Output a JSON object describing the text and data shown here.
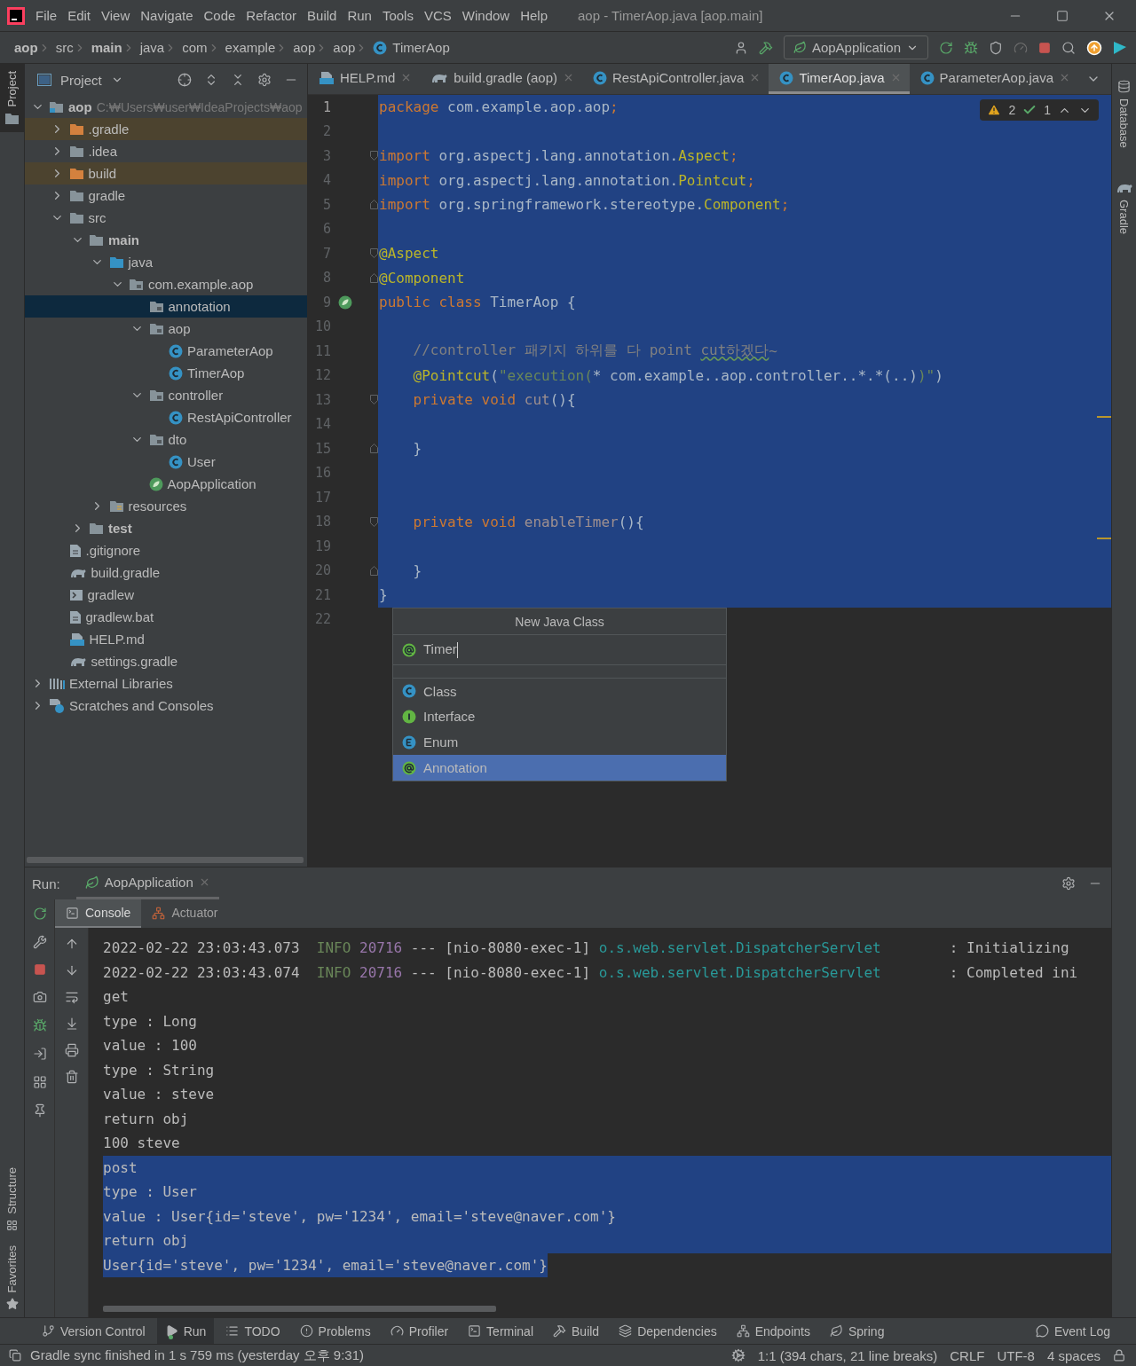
{
  "title_bar": {
    "menu": [
      "File",
      "Edit",
      "View",
      "Navigate",
      "Code",
      "Refactor",
      "Build",
      "Run",
      "Tools",
      "VCS",
      "Window",
      "Help"
    ],
    "title": "aop - TimerAop.java [aop.main]"
  },
  "breadcrumbs": [
    {
      "label": "aop",
      "kind": "dir",
      "bold": true
    },
    {
      "label": "src",
      "kind": "dir",
      "bold": false
    },
    {
      "label": "main",
      "kind": "dir",
      "bold": true
    },
    {
      "label": "java",
      "kind": "dir",
      "bold": false
    },
    {
      "label": "com",
      "kind": "dir",
      "bold": false
    },
    {
      "label": "example",
      "kind": "dir",
      "bold": false
    },
    {
      "label": "aop",
      "kind": "dir",
      "bold": false
    },
    {
      "label": "aop",
      "kind": "dir",
      "bold": false
    },
    {
      "label": "TimerAop",
      "kind": "class",
      "bold": false
    }
  ],
  "run_config": "AopApplication",
  "left_stripe": {
    "top": [
      {
        "label": "Project",
        "selected": true
      }
    ],
    "bottom": [
      {
        "label": "Structure",
        "selected": false
      },
      {
        "label": "Favorites",
        "selected": false
      }
    ]
  },
  "right_stripe": [
    {
      "label": "Database",
      "kind": "database"
    },
    {
      "label": "Gradle",
      "kind": "gradle"
    }
  ],
  "project_panel": {
    "title": "Project",
    "tree": [
      {
        "label": "aop",
        "kind": "module",
        "bold": true,
        "path": "C:₩Users₩user₩IdeaProjects₩aop",
        "expanded": true,
        "selected": false,
        "children": [
          {
            "label": ".gradle",
            "kind": "folder-excluded",
            "expanded": false,
            "selected": false
          },
          {
            "label": ".idea",
            "kind": "folder",
            "expanded": false,
            "selected": false
          },
          {
            "label": "build",
            "kind": "folder-excluded",
            "expanded": false,
            "selected": false
          },
          {
            "label": "gradle",
            "kind": "folder",
            "expanded": false,
            "selected": false
          },
          {
            "label": "src",
            "kind": "folder",
            "expanded": true,
            "selected": false,
            "children": [
              {
                "label": "main",
                "kind": "folder",
                "bold": true,
                "expanded": true,
                "selected": false,
                "children": [
                  {
                    "label": "java",
                    "kind": "source-folder",
                    "expanded": true,
                    "selected": false,
                    "children": [
                      {
                        "label": "com.example.aop",
                        "kind": "package",
                        "expanded": true,
                        "selected": false,
                        "children": [
                          {
                            "label": "annotation",
                            "kind": "package",
                            "selected": true
                          },
                          {
                            "label": "aop",
                            "kind": "package",
                            "expanded": true,
                            "selected": false,
                            "children": [
                              {
                                "label": "ParameterAop",
                                "kind": "class",
                                "selected": false
                              },
                              {
                                "label": "TimerAop",
                                "kind": "class",
                                "selected": false
                              }
                            ]
                          },
                          {
                            "label": "controller",
                            "kind": "package",
                            "expanded": true,
                            "selected": false,
                            "children": [
                              {
                                "label": "RestApiController",
                                "kind": "class",
                                "selected": false
                              }
                            ]
                          },
                          {
                            "label": "dto",
                            "kind": "package",
                            "expanded": true,
                            "selected": false,
                            "children": [
                              {
                                "label": "User",
                                "kind": "class",
                                "selected": false
                              }
                            ]
                          },
                          {
                            "label": "AopApplication",
                            "kind": "spring",
                            "selected": false
                          }
                        ]
                      }
                    ]
                  },
                  {
                    "label": "resources",
                    "kind": "resources",
                    "expanded": false,
                    "selected": false
                  }
                ]
              },
              {
                "label": "test",
                "kind": "folder",
                "bold": true,
                "expanded": false,
                "selected": false
              }
            ]
          },
          {
            "label": ".gitignore",
            "kind": "file",
            "selected": false
          },
          {
            "label": "build.gradle",
            "kind": "gradle",
            "selected": false
          },
          {
            "label": "gradlew",
            "kind": "script",
            "selected": false
          },
          {
            "label": "gradlew.bat",
            "kind": "file",
            "selected": false
          },
          {
            "label": "HELP.md",
            "kind": "md",
            "selected": false
          },
          {
            "label": "settings.gradle",
            "kind": "gradle",
            "selected": false
          }
        ]
      },
      {
        "label": "External Libraries",
        "kind": "libraries",
        "expanded": false,
        "selected": false
      },
      {
        "label": "Scratches and Consoles",
        "kind": "scratches",
        "expanded": false,
        "selected": false
      }
    ]
  },
  "editor": {
    "tabs": [
      {
        "label": "HELP.md",
        "kind": "md",
        "selected": false
      },
      {
        "label": "build.gradle (aop)",
        "kind": "gradle",
        "selected": false
      },
      {
        "label": "RestApiController.java",
        "kind": "class",
        "selected": false
      },
      {
        "label": "TimerAop.java",
        "kind": "class",
        "selected": true
      },
      {
        "label": "ParameterAop.java",
        "kind": "class",
        "selected": false
      }
    ],
    "inspections": {
      "warnings": "2",
      "weak_warnings": "1"
    },
    "lines": [
      {
        "number": "1",
        "current": true,
        "selected": true,
        "tokens": [
          {
            "text": "package",
            "kind": "kw"
          },
          {
            "text": " com.example.aop.aop",
            "kind": "id"
          },
          {
            "text": ";",
            "kind": "kw"
          }
        ]
      },
      {
        "number": "2",
        "selected": true
      },
      {
        "number": "3",
        "selected": true,
        "fold_start": true,
        "tokens": [
          {
            "text": "import",
            "kind": "kw"
          },
          {
            "text": " org.aspectj.lang.annotation.",
            "kind": "id"
          },
          {
            "text": "Aspect",
            "kind": "ann"
          },
          {
            "text": ";",
            "kind": "kw"
          }
        ]
      },
      {
        "number": "4",
        "selected": true,
        "tokens": [
          {
            "text": "import",
            "kind": "kw"
          },
          {
            "text": " org.aspectj.lang.annotation.",
            "kind": "id"
          },
          {
            "text": "Pointcut",
            "kind": "ann"
          },
          {
            "text": ";",
            "kind": "kw"
          }
        ]
      },
      {
        "number": "5",
        "selected": true,
        "fold_end": true,
        "tokens": [
          {
            "text": "import",
            "kind": "kw"
          },
          {
            "text": " org.springframework.stereotype.",
            "kind": "id"
          },
          {
            "text": "Component",
            "kind": "ann"
          },
          {
            "text": ";",
            "kind": "kw"
          }
        ]
      },
      {
        "number": "6",
        "selected": true
      },
      {
        "number": "7",
        "selected": true,
        "fold_start": true,
        "tokens": [
          {
            "text": "@Aspect",
            "kind": "ann"
          }
        ]
      },
      {
        "number": "8",
        "selected": true,
        "fold_end": true,
        "tokens": [
          {
            "text": "@Component",
            "kind": "ann"
          }
        ]
      },
      {
        "number": "9",
        "selected": true,
        "bean": true,
        "tokens": [
          {
            "text": "public class",
            "kind": "kw"
          },
          {
            "text": " TimerAop {",
            "kind": "id"
          }
        ]
      },
      {
        "number": "10",
        "selected": true
      },
      {
        "number": "11",
        "selected": true,
        "tokens": [
          {
            "text": "    //controller 패키지 하위를 다 point ",
            "kind": "cmt"
          },
          {
            "text": "cut하겠다",
            "kind": "typo"
          },
          {
            "text": "~",
            "kind": "cmt"
          }
        ]
      },
      {
        "number": "12",
        "selected": true,
        "tokens": [
          {
            "text": "    @Pointcut",
            "kind": "ann"
          },
          {
            "text": "(",
            "kind": "id"
          },
          {
            "text": "\"execution(",
            "kind": "str"
          },
          {
            "text": "* com.example..aop.controller..*.*(..)",
            "kind": "id"
          },
          {
            "text": ")\"",
            "kind": "str"
          },
          {
            "text": ")",
            "kind": "id"
          }
        ]
      },
      {
        "number": "13",
        "selected": true,
        "fold_start": true,
        "tokens": [
          {
            "text": "    private void ",
            "kind": "kw"
          },
          {
            "text": "cut",
            "kind": "unused"
          },
          {
            "text": "(){",
            "kind": "id"
          }
        ]
      },
      {
        "number": "14",
        "selected": true
      },
      {
        "number": "15",
        "selected": true,
        "fold_end": true,
        "tokens": [
          {
            "text": "    }",
            "kind": "id"
          }
        ]
      },
      {
        "number": "16",
        "selected": true
      },
      {
        "number": "17",
        "selected": true
      },
      {
        "number": "18",
        "selected": true,
        "fold_start": true,
        "tokens": [
          {
            "text": "    private void ",
            "kind": "kw"
          },
          {
            "text": "enableTimer",
            "kind": "unused"
          },
          {
            "text": "(){",
            "kind": "id"
          }
        ]
      },
      {
        "number": "19",
        "selected": true
      },
      {
        "number": "20",
        "selected": true,
        "fold_end": true,
        "tokens": [
          {
            "text": "    }",
            "kind": "id"
          }
        ]
      },
      {
        "number": "21",
        "selected": true,
        "tokens": [
          {
            "text": "}",
            "kind": "id"
          }
        ]
      },
      {
        "number": "22",
        "selected": false
      }
    ]
  },
  "popup": {
    "title": "New Java Class",
    "value": "Timer",
    "options": [
      {
        "label": "Class",
        "kind": "class",
        "selected": false
      },
      {
        "label": "Interface",
        "kind": "interface",
        "selected": false
      },
      {
        "label": "Enum",
        "kind": "enum",
        "selected": false
      },
      {
        "label": "Annotation",
        "kind": "annotation",
        "selected": true
      }
    ]
  },
  "run_panel": {
    "label": "Run:",
    "tab": "AopApplication",
    "subtabs": [
      {
        "label": "Console",
        "kind": "console",
        "selected": true
      },
      {
        "label": "Actuator",
        "kind": "actuator",
        "selected": false
      }
    ],
    "lines": [
      {
        "kind": "log",
        "date": "2022-02-22 23:03:43.073",
        "level": "INFO",
        "pid": "20716",
        "sep": "---",
        "thread": "[nio-8080-exec-1]",
        "logger": "o.s.web.servlet.DispatcherServlet",
        "colon": ":",
        "message": "Initializing"
      },
      {
        "kind": "log",
        "date": "2022-02-22 23:03:43.074",
        "level": "INFO",
        "pid": "20716",
        "sep": "---",
        "thread": "[nio-8080-exec-1]",
        "logger": "o.s.web.servlet.DispatcherServlet",
        "colon": ":",
        "message": "Completed ini"
      },
      {
        "kind": "plain",
        "text": "get"
      },
      {
        "kind": "plain",
        "text": "type : Long"
      },
      {
        "kind": "plain",
        "text": "value : 100"
      },
      {
        "kind": "plain",
        "text": "type : String"
      },
      {
        "kind": "plain",
        "text": "value : steve"
      },
      {
        "kind": "plain",
        "text": "return obj"
      },
      {
        "kind": "plain",
        "text": "100 steve"
      },
      {
        "kind": "highlighted",
        "text": "post"
      },
      {
        "kind": "highlighted",
        "text": "type : User"
      },
      {
        "kind": "highlighted",
        "text": "value : User{id='steve', pw='1234', email='steve@naver.com'}"
      },
      {
        "kind": "highlighted",
        "text": "return obj"
      },
      {
        "kind": "highlighted-text",
        "text": "User{id='steve', pw='1234', email='steve@naver.com'}"
      }
    ]
  },
  "tool_windows": [
    {
      "label": "Version Control",
      "kind": "vcs",
      "selected": false
    },
    {
      "label": "Run",
      "kind": "run",
      "selected": true
    },
    {
      "label": "TODO",
      "kind": "todo",
      "selected": false
    },
    {
      "label": "Problems",
      "kind": "problems",
      "selected": false
    },
    {
      "label": "Profiler",
      "kind": "profiler",
      "selected": false
    },
    {
      "label": "Terminal",
      "kind": "terminal",
      "selected": false
    },
    {
      "label": "Build",
      "kind": "build",
      "selected": false
    },
    {
      "label": "Dependencies",
      "kind": "dependencies",
      "selected": false
    },
    {
      "label": "Endpoints",
      "kind": "endpoints",
      "selected": false
    },
    {
      "label": "Spring",
      "kind": "spring",
      "selected": false
    }
  ],
  "event_log": "Event Log",
  "status_bar": {
    "message": "Gradle sync finished in 1 s 759 ms (yesterday 오후 9:31)",
    "position": "1:1 (394 chars, 21 line breaks)",
    "line_separator": "CRLF",
    "encoding": "UTF-8",
    "indent": "4 spaces"
  }
}
